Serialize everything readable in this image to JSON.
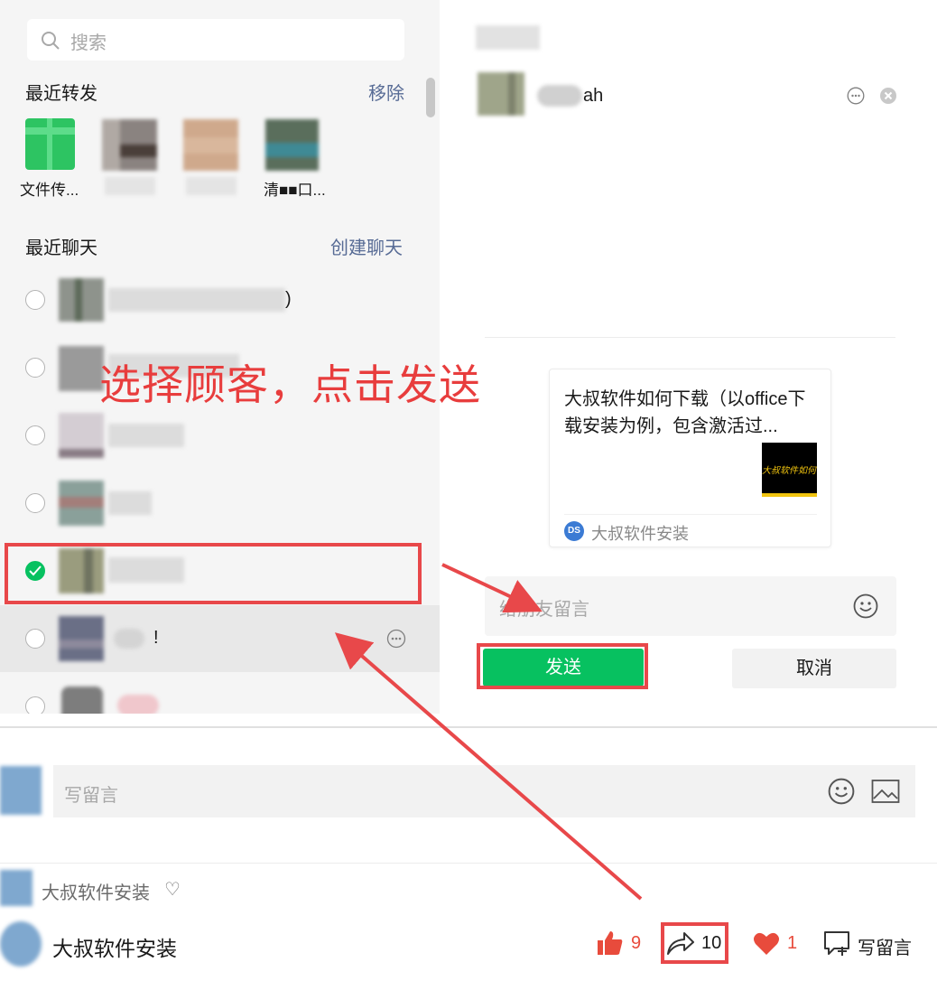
{
  "search": {
    "placeholder": "搜索"
  },
  "recent_forward": {
    "title": "最近转发",
    "action": "移除",
    "items": [
      {
        "label": "文件传..."
      },
      {
        "label": ""
      },
      {
        "label": ""
      },
      {
        "label": "清■■口..."
      }
    ]
  },
  "recent_chats": {
    "title": "最近聊天",
    "action": "创建聊天",
    "rows": [
      {
        "suffix": ")",
        "checked": false
      },
      {
        "suffix": "",
        "checked": false
      },
      {
        "suffix": "",
        "checked": false
      },
      {
        "suffix": "",
        "checked": false
      },
      {
        "suffix": "",
        "checked": true
      },
      {
        "suffix": "!",
        "checked": false
      },
      {
        "suffix": "",
        "checked": false
      }
    ]
  },
  "selected_contact": {
    "name_suffix": "ah"
  },
  "article_card": {
    "title": "大叔软件如何下载（以office下载安装为例，包含激活过...",
    "thumbnail_text": "大叔软件如何下载",
    "source_logo": "DS",
    "source": "大叔软件安装"
  },
  "message_input": {
    "placeholder": "给朋友留言"
  },
  "buttons": {
    "send": "发送",
    "cancel": "取消"
  },
  "annotation": {
    "text": "选择顾客，点击发送"
  },
  "comment_box": {
    "placeholder": "写留言"
  },
  "author_line": {
    "name": "大叔软件安装",
    "heart": "♡"
  },
  "footer": {
    "account_name": "大叔软件安装",
    "like_count": "9",
    "share_count": "10",
    "favorite_count": "1",
    "comment_label": "写留言"
  },
  "colors": {
    "accent_green": "#07c160",
    "annotation_red": "#e8484a",
    "link_blue": "#576b95"
  }
}
